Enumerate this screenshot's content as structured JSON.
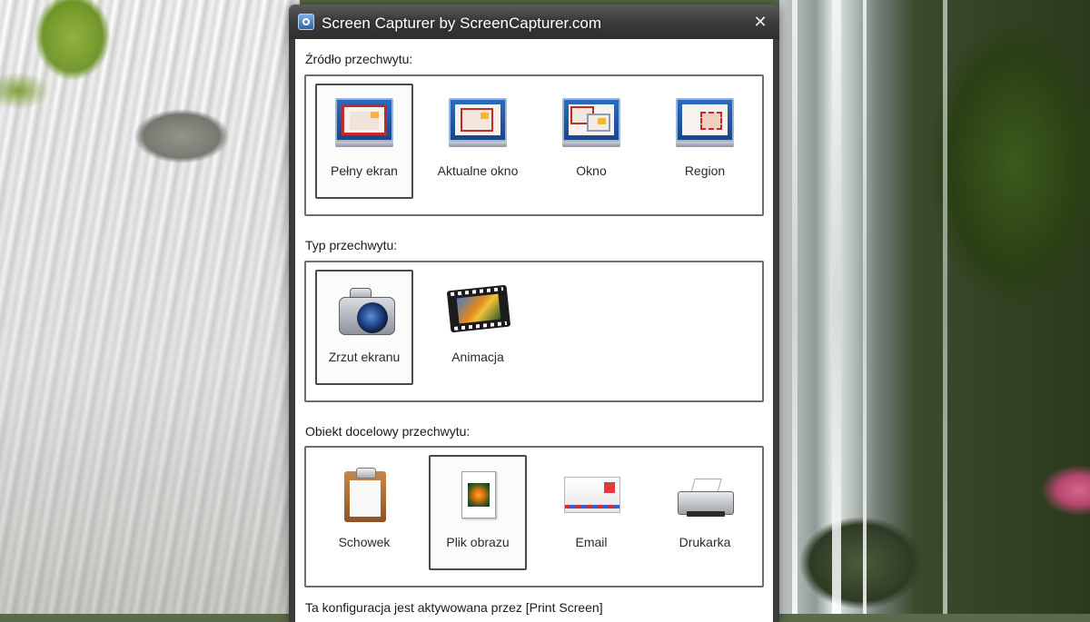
{
  "window": {
    "title": "Screen Capturer by ScreenCapturer.com",
    "close_glyph": "✕"
  },
  "capture_source": {
    "label": "Źródło przechwytu:",
    "options": [
      {
        "label": "Pełny ekran",
        "icon": "full-screen-icon",
        "selected": true
      },
      {
        "label": "Aktualne okno",
        "icon": "active-window-icon",
        "selected": false
      },
      {
        "label": "Okno",
        "icon": "window-icon",
        "selected": false
      },
      {
        "label": "Region",
        "icon": "region-icon",
        "selected": false
      }
    ]
  },
  "capture_type": {
    "label": "Typ przechwytu:",
    "options": [
      {
        "label": "Zrzut ekranu",
        "icon": "camera-icon",
        "selected": true
      },
      {
        "label": "Animacja",
        "icon": "film-strip-icon",
        "selected": false
      }
    ]
  },
  "capture_target": {
    "label": "Obiekt docelowy przechwytu:",
    "options": [
      {
        "label": "Schowek",
        "icon": "clipboard-icon",
        "selected": false
      },
      {
        "label": "Plik obrazu",
        "icon": "image-file-icon",
        "selected": true
      },
      {
        "label": "Email",
        "icon": "envelope-icon",
        "selected": false
      },
      {
        "label": "Drukarka",
        "icon": "printer-icon",
        "selected": false
      }
    ]
  },
  "footer": {
    "text": "Ta konfiguracja jest aktywowana przez [Print Screen]"
  },
  "colors": {
    "selection_border": "#4a4a4a",
    "group_border": "#6e6e6e",
    "titlebar": "#3b3b3b"
  }
}
